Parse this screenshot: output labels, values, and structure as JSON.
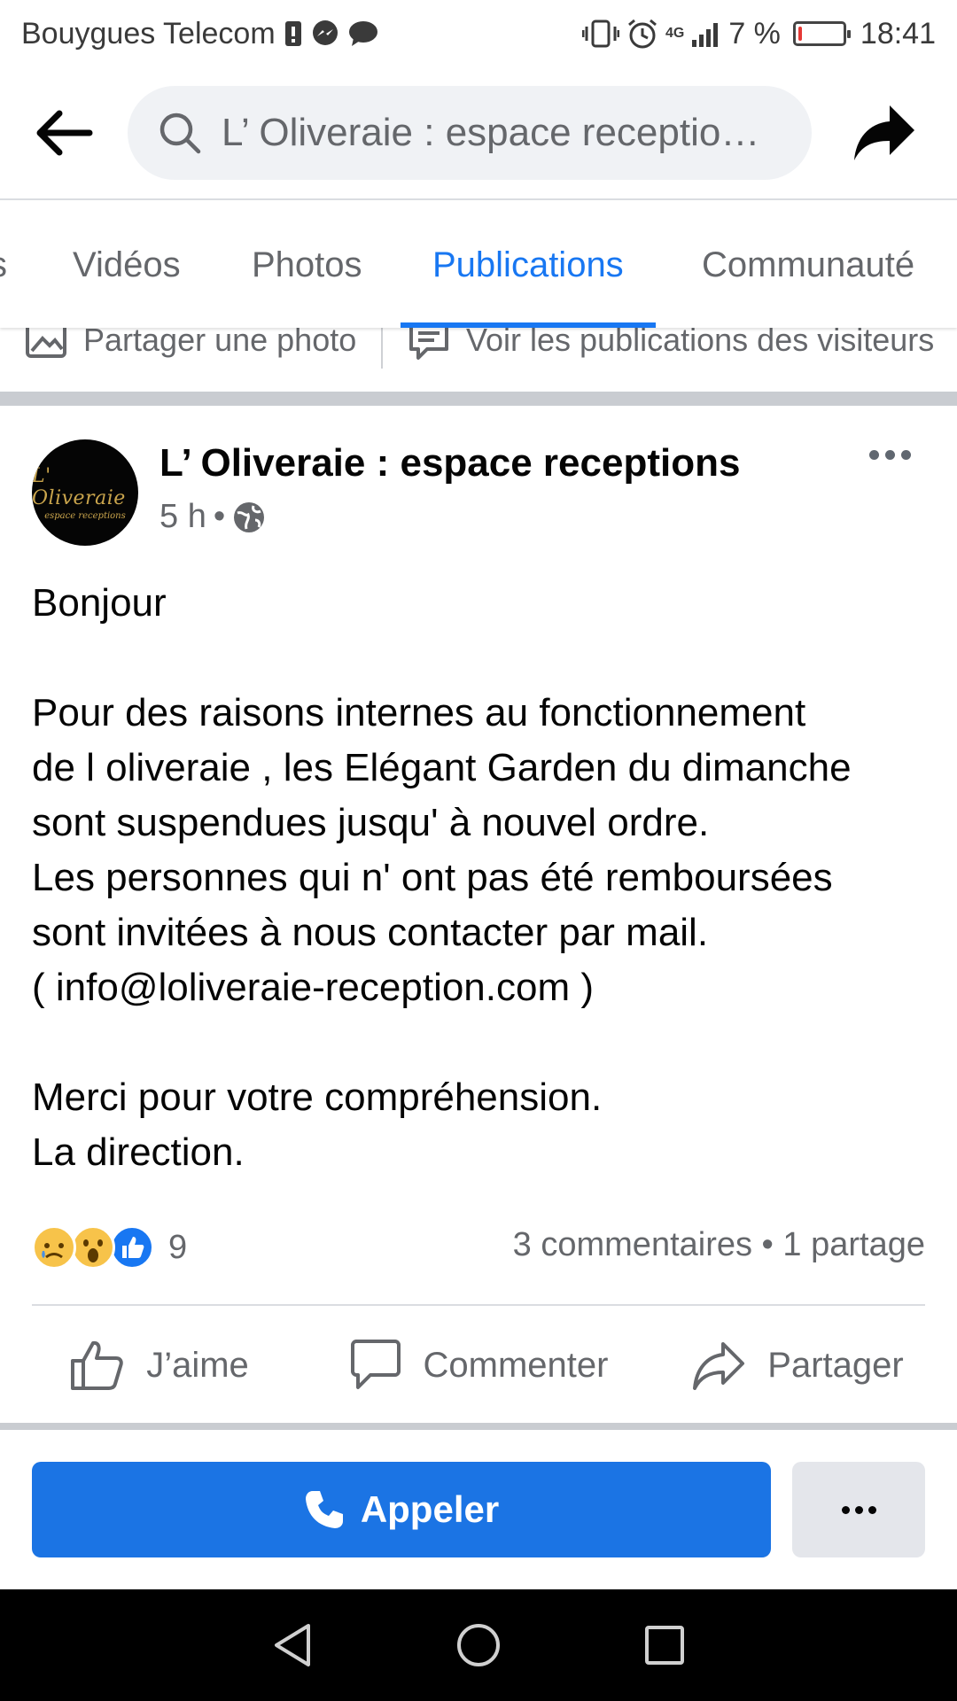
{
  "status_bar": {
    "carrier": "Bouygues Telecom",
    "network": "4G",
    "battery_text": "7 %",
    "battery_level": 0.07,
    "time": "18:41"
  },
  "header": {
    "search_placeholder": "L’ Oliveraie : espace receptio…",
    "back_icon": "arrow-left-icon",
    "share_icon": "share-arrow-icon"
  },
  "tabs": [
    {
      "label": "s"
    },
    {
      "label": "Vidéos"
    },
    {
      "label": "Photos"
    },
    {
      "label": "Publications",
      "active": true
    },
    {
      "label": "Communauté"
    }
  ],
  "hidden_row": {
    "share_photo": "Partager une photo",
    "visitor_posts": "Voir les publications des visiteurs"
  },
  "post": {
    "page_name": "L’ Oliveraie : espace receptions",
    "time": "5 h",
    "dot": "•",
    "audience_icon": "globe-icon",
    "avatar_logo": "L' Oliveraie",
    "avatar_sub": "espace receptions",
    "body_lines": [
      "Bonjour",
      "",
      "Pour des raisons internes au fonctionnement",
      "de l oliveraie , les Elégant Garden du dimanche",
      "sont suspendues jusqu' à nouvel ordre.",
      "Les personnes qui n' ont pas été remboursées",
      "sont invitées à nous contacter par mail.",
      "( info@loliveraie-reception.com )",
      "",
      "Merci pour votre compréhension.",
      "La direction."
    ],
    "reaction_count": "9",
    "stats": "3 commentaires • 1 partage",
    "actions": {
      "like": "J’aime",
      "comment": "Commenter",
      "share": "Partager"
    }
  },
  "bottom": {
    "call_label": "Appeler"
  },
  "colors": {
    "accent": "#1877f2",
    "call_button": "#1b74e4",
    "secondary_text": "#65676b"
  }
}
